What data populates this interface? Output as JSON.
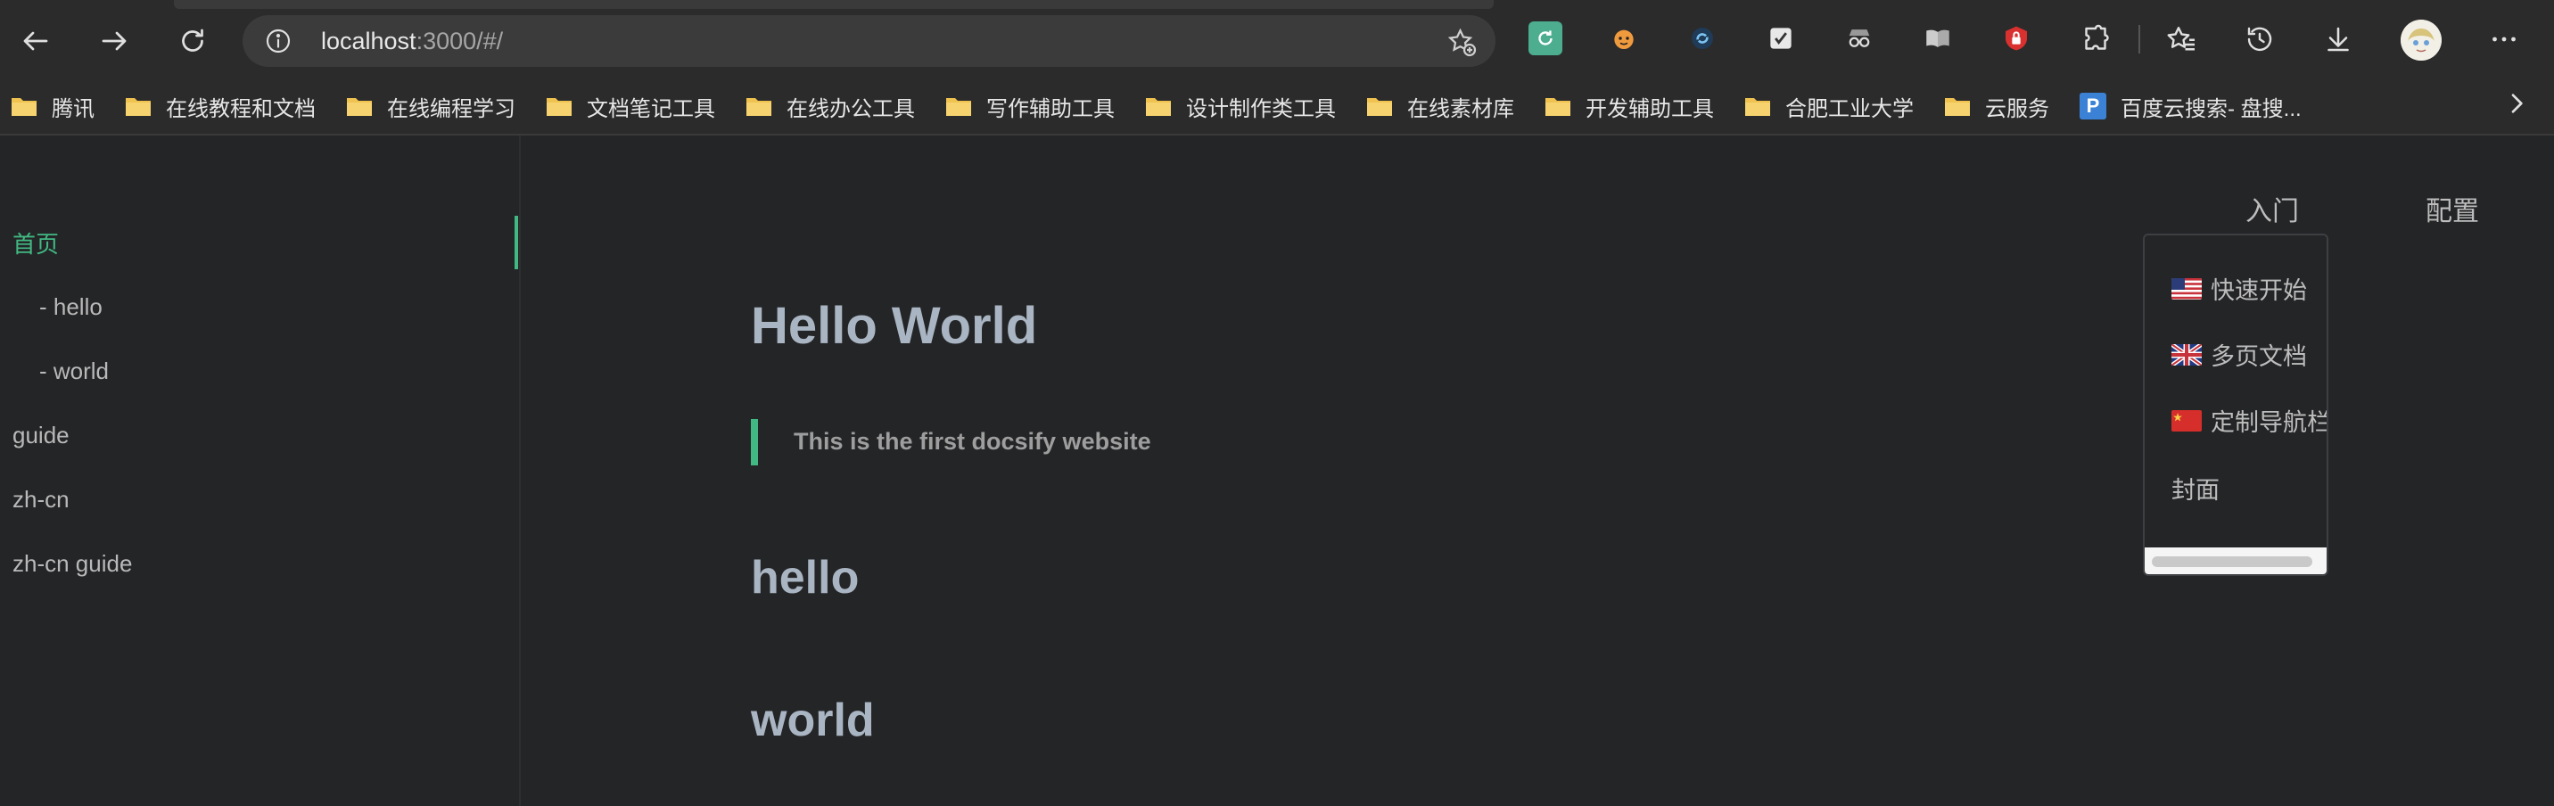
{
  "browser": {
    "url_host": "localhost",
    "url_path": ":3000/#/",
    "bookmarks": [
      {
        "label": "腾讯",
        "icon": "folder-icon"
      },
      {
        "label": "在线教程和文档",
        "icon": "folder-icon"
      },
      {
        "label": "在线编程学习",
        "icon": "folder-icon"
      },
      {
        "label": "文档笔记工具",
        "icon": "folder-icon"
      },
      {
        "label": "在线办公工具",
        "icon": "folder-icon"
      },
      {
        "label": "写作辅助工具",
        "icon": "folder-icon"
      },
      {
        "label": "设计制作类工具",
        "icon": "folder-icon"
      },
      {
        "label": "在线素材库",
        "icon": "folder-icon"
      },
      {
        "label": "开发辅助工具",
        "icon": "folder-icon"
      },
      {
        "label": "合肥工业大学",
        "icon": "folder-icon"
      },
      {
        "label": "云服务",
        "icon": "folder-icon"
      },
      {
        "label": "百度云搜索- 盘搜...",
        "icon": "p-logo-icon"
      }
    ],
    "colors": {
      "chrome": "#2b2b2b",
      "omnibox": "#3b3b3b",
      "folder": "#f0c350"
    }
  },
  "sidebar": {
    "items": [
      {
        "label": "首页",
        "active": true
      },
      {
        "label": "- hello"
      },
      {
        "label": "- world"
      },
      {
        "label": "guide"
      },
      {
        "label": "zh-cn"
      },
      {
        "label": "zh-cn guide"
      }
    ]
  },
  "navbar": {
    "items": [
      "入门",
      "配置"
    ],
    "dropdown": [
      {
        "label": "快速开始",
        "flag": "us-flag-icon"
      },
      {
        "label": "多页文档",
        "flag": "uk-flag-icon"
      },
      {
        "label": "定制导航栏",
        "flag": "cn-flag-icon"
      },
      {
        "label": "封面",
        "flag": ""
      }
    ]
  },
  "content": {
    "title": "Hello World",
    "quote": "This is the first docsify website",
    "sections": [
      "hello",
      "world"
    ]
  },
  "theme": {
    "accent": "#42b983",
    "background": "#242527",
    "heading": "#a9b5c2"
  }
}
